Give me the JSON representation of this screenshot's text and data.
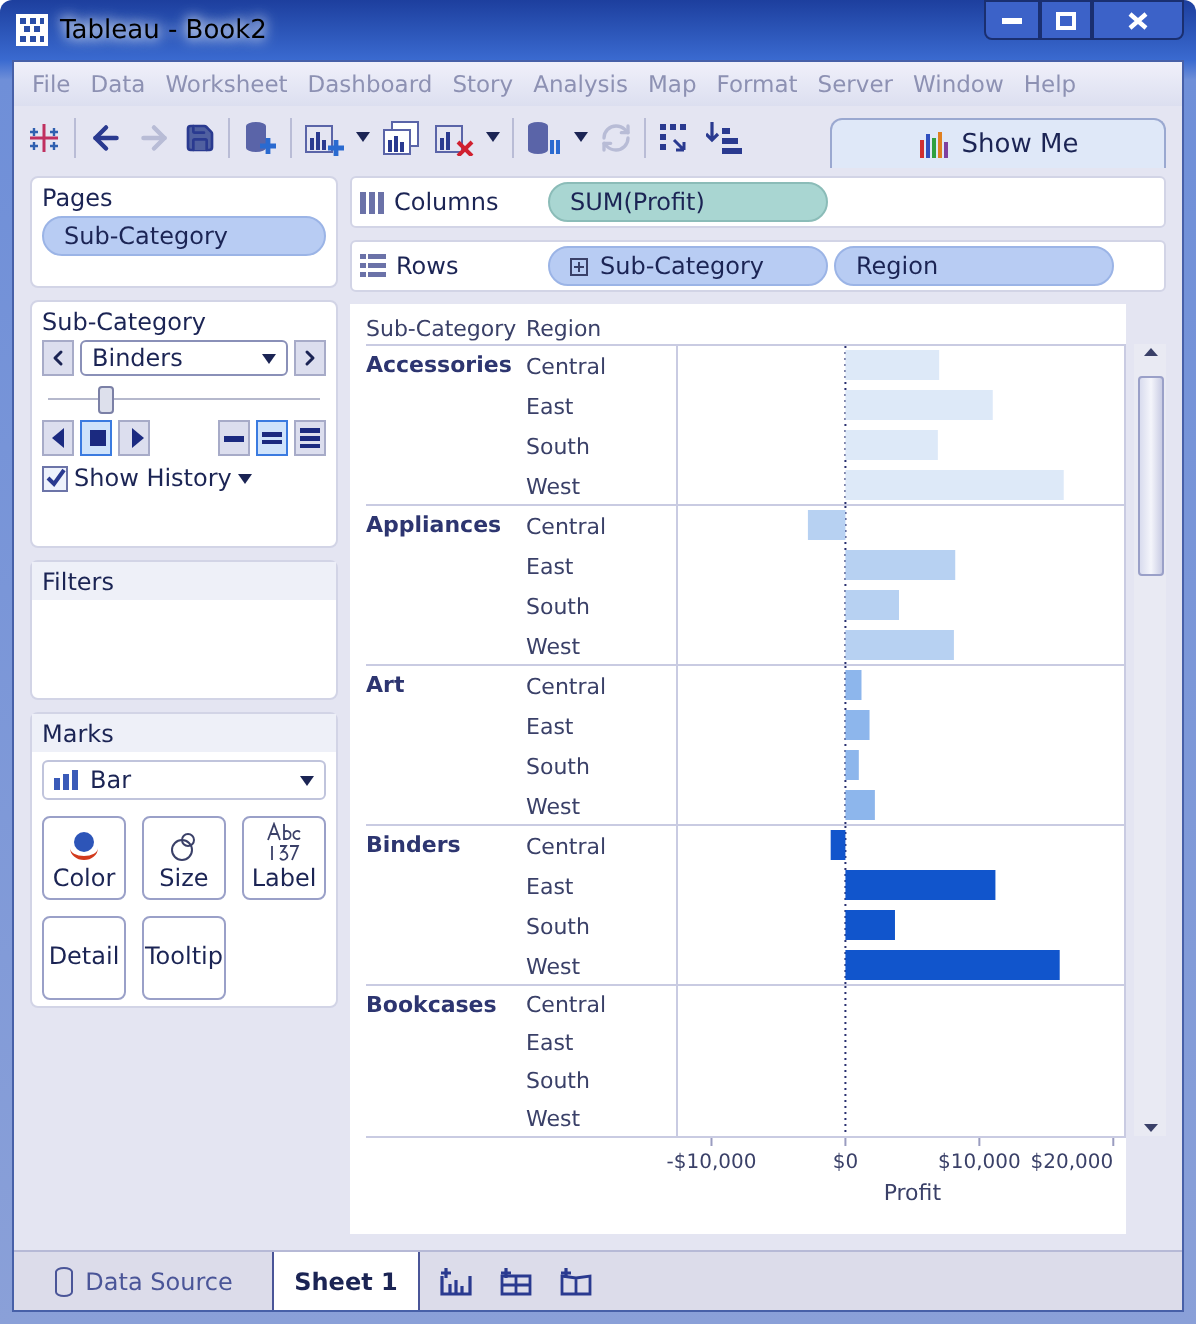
{
  "window": {
    "title": "Tableau - Book2"
  },
  "menu": [
    "File",
    "Data",
    "Worksheet",
    "Dashboard",
    "Story",
    "Analysis",
    "Map",
    "Format",
    "Server",
    "Window",
    "Help"
  ],
  "toolbar": {
    "show_me": "Show Me"
  },
  "pages": {
    "title": "Pages",
    "pill": "Sub-Category"
  },
  "page_control": {
    "title": "Sub-Category",
    "value": "Binders",
    "slider": {
      "level": 0.21
    },
    "playback": [
      {
        "kind": "back",
        "selected": false
      },
      {
        "kind": "stop",
        "selected": true
      },
      {
        "kind": "forward",
        "selected": false
      }
    ],
    "speed": [
      {
        "kind": "slow",
        "selected": false
      },
      {
        "kind": "medium",
        "selected": true
      },
      {
        "kind": "fast",
        "selected": false
      }
    ],
    "show_history": {
      "label": "Show History",
      "checked": true
    }
  },
  "filters": {
    "title": "Filters"
  },
  "marks": {
    "title": "Marks",
    "type": "Bar",
    "buttons": [
      {
        "label": "Color",
        "kind": "color"
      },
      {
        "label": "Size",
        "kind": "size"
      },
      {
        "label": "Label",
        "kind": "label"
      },
      {
        "label": "Detail",
        "kind": "plain"
      },
      {
        "label": "Tooltip",
        "kind": "plain"
      }
    ]
  },
  "shelves": [
    {
      "label": "Columns",
      "kind": "columns",
      "pills": [
        {
          "text": "SUM(Profit)",
          "kind": "measure",
          "expandable": false
        }
      ]
    },
    {
      "label": "Rows",
      "kind": "rows",
      "pills": [
        {
          "text": "Sub-Category",
          "kind": "dimension",
          "expandable": true
        },
        {
          "text": "Region",
          "kind": "dimension",
          "expandable": false
        }
      ]
    }
  ],
  "view": {
    "headers": [
      "Sub-Category",
      "Region"
    ],
    "row_groups": [
      "Accessories",
      "Appliances",
      "Art",
      "Binders",
      "Bookcases"
    ],
    "chart_data": {
      "type": "bar",
      "orientation": "horizontal",
      "grid": true,
      "xlabel": "Profit",
      "xlim": [
        -12500,
        20800
      ],
      "categories": [
        "Central",
        "East",
        "South",
        "West",
        "Central",
        "East",
        "South",
        "West",
        "Central",
        "East",
        "South",
        "West",
        "Central",
        "East",
        "South",
        "West",
        "Central",
        "East",
        "South",
        "West"
      ],
      "xticks": [
        {
          "value": -10000,
          "label": "-$10,000"
        },
        {
          "value": 0,
          "label": "$0"
        },
        {
          "value": 10000,
          "label": "$10,000"
        },
        {
          "value": 20000,
          "label": "$20,000"
        }
      ],
      "series": [
        {
          "color": "#dde9f8",
          "values": [
            7000,
            11000,
            6900,
            16300,
            null,
            null,
            null,
            null,
            null,
            null,
            null,
            null,
            null,
            null,
            null,
            null,
            null,
            null,
            null,
            null
          ]
        },
        {
          "color": "#b7d1f2",
          "values": [
            null,
            null,
            null,
            null,
            -2800,
            8200,
            4000,
            8100,
            null,
            null,
            null,
            null,
            null,
            null,
            null,
            null,
            null,
            null,
            null,
            null
          ]
        },
        {
          "color": "#8db6ec",
          "values": [
            null,
            null,
            null,
            null,
            null,
            null,
            null,
            null,
            1200,
            1800,
            1000,
            2200,
            null,
            null,
            null,
            null,
            null,
            null,
            null,
            null
          ]
        },
        {
          "color": "#1155cc",
          "values": [
            null,
            null,
            null,
            null,
            null,
            null,
            null,
            null,
            null,
            null,
            null,
            null,
            -1100,
            11200,
            3700,
            16000,
            null,
            null,
            null,
            null
          ]
        }
      ]
    }
  },
  "sheet_tabs": [
    {
      "label": "Data Source",
      "kind": "data",
      "selected": false
    },
    {
      "label": "Sheet 1",
      "kind": "sheet",
      "selected": true
    }
  ]
}
